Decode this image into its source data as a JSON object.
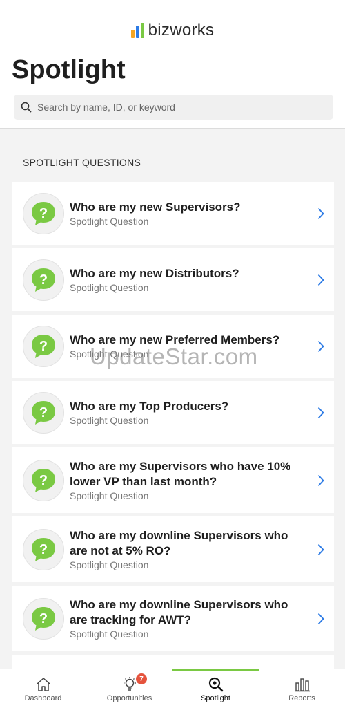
{
  "brand": {
    "name": "bizworks",
    "colors": [
      "#f5a623",
      "#2d7be5",
      "#7ac943"
    ]
  },
  "page": {
    "title": "Spotlight"
  },
  "search": {
    "placeholder": "Search by name, ID, or keyword",
    "icon": "search-icon"
  },
  "section": {
    "title": "SPOTLIGHT QUESTIONS"
  },
  "questions": [
    {
      "title": "Who are my new Supervisors?",
      "subtitle": "Spotlight Question"
    },
    {
      "title": "Who are my new Distributors?",
      "subtitle": "Spotlight Question"
    },
    {
      "title": "Who are my new Preferred Members?",
      "subtitle": "Spotlight Question"
    },
    {
      "title": "Who are my Top Producers?",
      "subtitle": "Spotlight Question"
    },
    {
      "title": "Who are my Supervisors who have 10% lower VP than last month?",
      "subtitle": "Spotlight Question"
    },
    {
      "title": "Who are my downline Supervisors who are not at 5% RO?",
      "subtitle": "Spotlight Question"
    },
    {
      "title": "Who are my downline Supervisors who are tracking for AWT?",
      "subtitle": "Spotlight Question"
    }
  ],
  "watermark": "UpdateStar.com",
  "tabs": [
    {
      "label": "Dashboard",
      "icon": "home-icon",
      "active": false
    },
    {
      "label": "Opportunities",
      "icon": "lightbulb-icon",
      "active": false,
      "badge": "7"
    },
    {
      "label": "Spotlight",
      "icon": "search-icon",
      "active": true
    },
    {
      "label": "Reports",
      "icon": "bar-chart-icon",
      "active": false
    }
  ],
  "colors": {
    "accent": "#7ac943",
    "badge": "#e5533d",
    "chevron": "#2d7be5"
  }
}
